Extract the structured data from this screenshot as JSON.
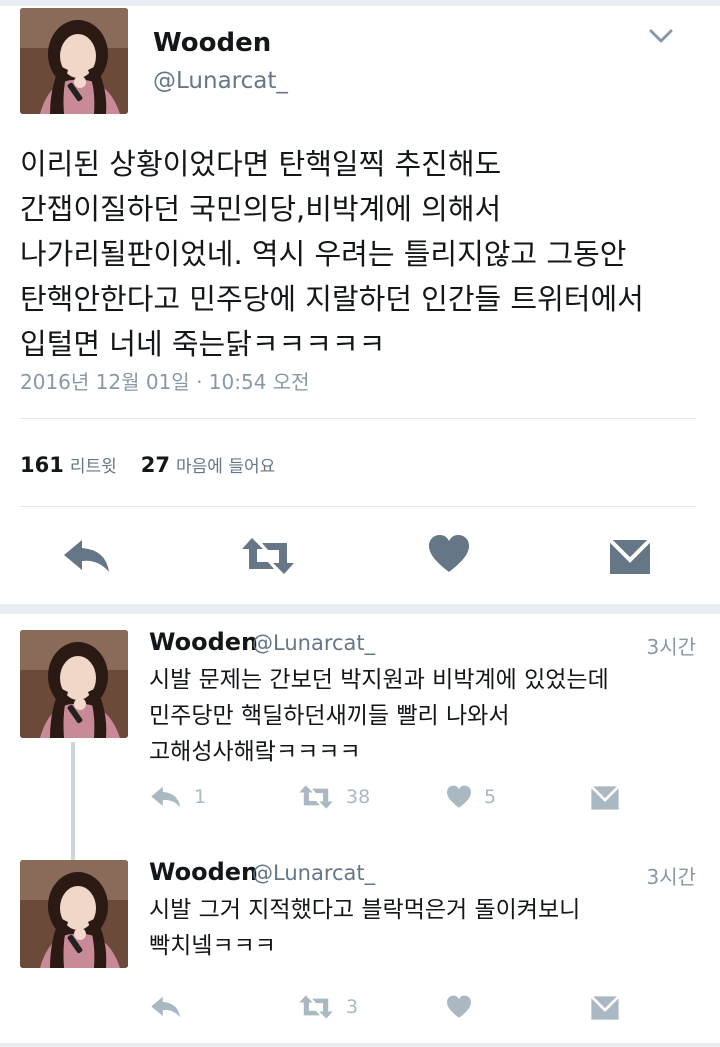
{
  "main_tweet": {
    "display_name": "Wooden",
    "handle": "@Lunarcat_",
    "text": "이리된 상황이었다면 탄핵일찍 추진해도\n간잽이질하던 국민의당,비박계에 의해서\n나가리될판이었네. 역시 우려는 틀리지않고 그동안\n탄핵안한다고 민주당에 지랄하던 인간들 트위터에서\n입털면 너네 죽는닭ㅋㅋㅋㅋㅋ",
    "timestamp": "2016년 12월 01일 · 10:54 오전",
    "retweet_count": "161",
    "retweet_label": "리트윗",
    "like_count": "27",
    "like_label": "마음에 들어요"
  },
  "replies": [
    {
      "display_name": "Wooden",
      "handle": "@Lunarcat_",
      "time": "3시간",
      "text": "시발 문제는 간보던 박지원과 비박계에 있었는데\n민주당만 핵딜하던새끼들 빨리 나와서\n고해성사해랔ㅋㅋㅋㅋ",
      "reply_count": "1",
      "retweet_count": "38",
      "like_count": "5"
    },
    {
      "display_name": "Wooden",
      "handle": "@Lunarcat_",
      "time": "3시간",
      "text": "시발 그거 지적했다고 블락먹은거 돌이켜보니\n빡치넼ㅋㅋㅋ",
      "retweet_count": "3"
    }
  ],
  "colors": {
    "accent_icon": "#657786",
    "muted_icon": "#aab8c2",
    "divider": "#e1e8ed"
  }
}
